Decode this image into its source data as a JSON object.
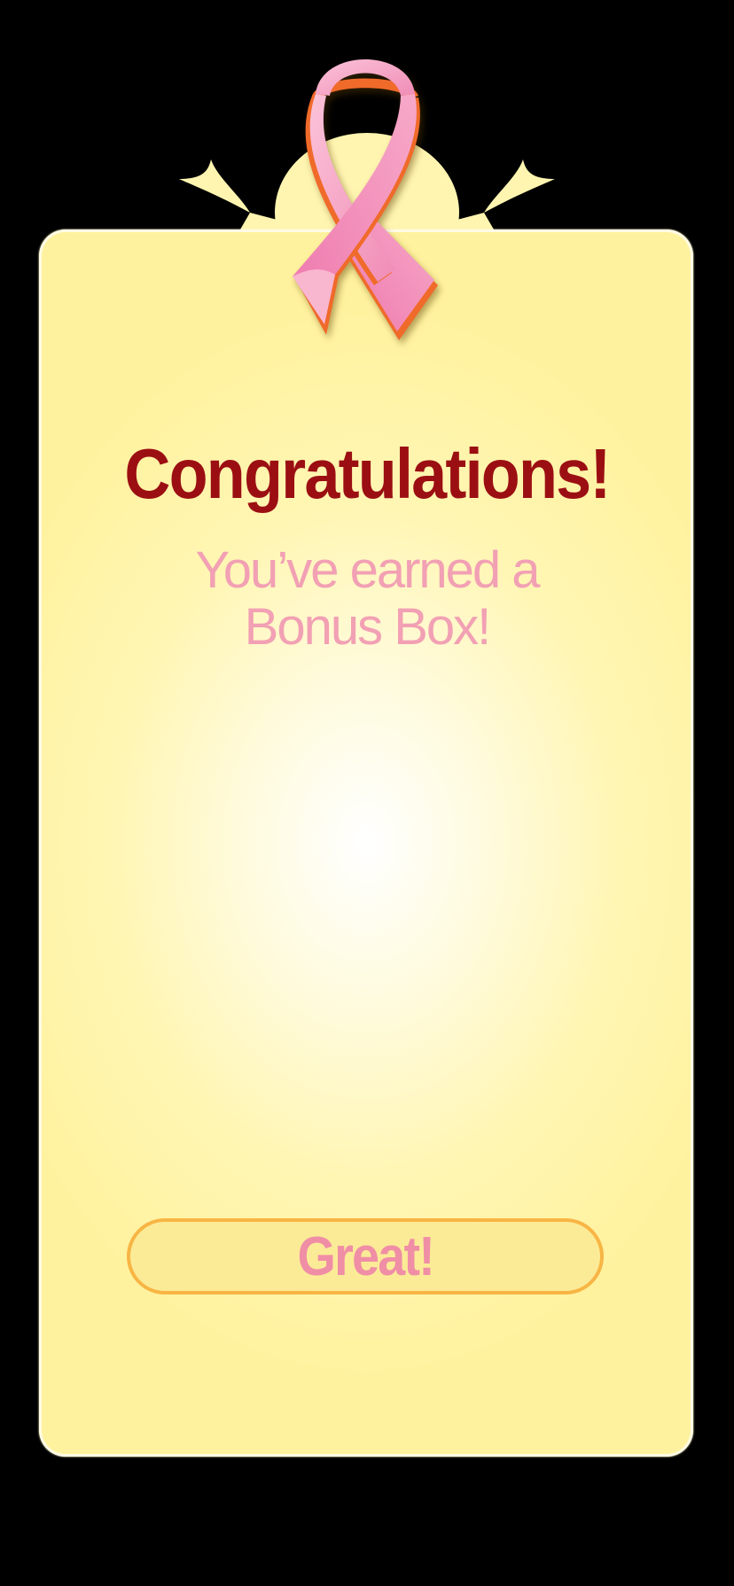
{
  "dialog": {
    "title": "Congratulations!",
    "message_lines": [
      "You’ve earned a",
      "Bonus Box!"
    ],
    "button_label": "Great!"
  },
  "icons": {
    "ribbon": "pink-awareness-ribbon-icon"
  },
  "colors": {
    "background": "#000000",
    "dialog_fill": "#fff29e",
    "title": "#9b0f13",
    "message": "#f2a0b4",
    "button_border": "#f8b544",
    "button_fill": "#fbeb97",
    "button_text": "#f08ea6",
    "ribbon_pink": "#f59bc0",
    "ribbon_edge": "#f06a2a"
  }
}
